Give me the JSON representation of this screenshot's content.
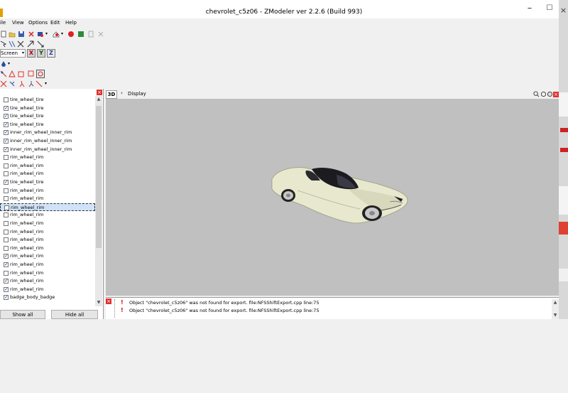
{
  "window": {
    "title": "chevrolet_c5z06 - ZModeler ver 2.2.6 (Build 993)",
    "minimize": "–",
    "maximize": "☐"
  },
  "menu": [
    {
      "label": "ile",
      "key": ""
    },
    {
      "label": "View",
      "key": "V"
    },
    {
      "label": "Options",
      "key": "O"
    },
    {
      "label": "Edit",
      "key": "E"
    },
    {
      "label": "Help",
      "key": "H"
    }
  ],
  "toolbar": {
    "view_mode": "Screen",
    "axis_x": "X",
    "axis_y": "Y",
    "axis_z": "Z"
  },
  "viewport": {
    "mode": "3D",
    "display_label": "Display"
  },
  "objects": [
    {
      "name": "tire_wheel_tire",
      "checked": false
    },
    {
      "name": "tire_wheel_tire",
      "checked": true
    },
    {
      "name": "tire_wheel_tire",
      "checked": true
    },
    {
      "name": "tire_wheel_tire",
      "checked": true
    },
    {
      "name": "inner_rim_wheel_inner_rim",
      "checked": true
    },
    {
      "name": "inner_rim_wheel_inner_rim",
      "checked": true
    },
    {
      "name": "inner_rim_wheel_inner_rim",
      "checked": true
    },
    {
      "name": "rim_wheel_rim",
      "checked": false
    },
    {
      "name": "rim_wheel_rim",
      "checked": false
    },
    {
      "name": "rim_wheel_rim",
      "checked": false
    },
    {
      "name": "tire_wheel_tire",
      "checked": true
    },
    {
      "name": "rim_wheel_rim",
      "checked": false
    },
    {
      "name": "rim_wheel_rim",
      "checked": false
    },
    {
      "name": "rim_wheel_rim",
      "checked": false,
      "selected": true
    },
    {
      "name": "rim_wheel_rim",
      "checked": false
    },
    {
      "name": "rim_wheel_rim",
      "checked": false
    },
    {
      "name": "rim_wheel_rim",
      "checked": false
    },
    {
      "name": "rim_wheel_rim",
      "checked": false
    },
    {
      "name": "rim_wheel_rim",
      "checked": false
    },
    {
      "name": "rim_wheel_rim",
      "checked": true
    },
    {
      "name": "rim_wheel_rim",
      "checked": true
    },
    {
      "name": "rim_wheel_rim",
      "checked": false
    },
    {
      "name": "rim_wheel_rim",
      "checked": true
    },
    {
      "name": "rim_wheel_rim",
      "checked": true
    },
    {
      "name": "badge_body_badge",
      "checked": true
    }
  ],
  "buttons": {
    "show_all": "Show all",
    "hide_all": "Hide all"
  },
  "log": [
    "Object \"chevrolet_c5z06\" was not found for export. file:NFSShiftExport.cpp line:75",
    "Object \"chevrolet_c5z06\" was not found for export. file:NFSShiftExport.cpp line:75"
  ],
  "colors": {
    "viewport_bg": "#c0c0c0",
    "car_body": "#e8e8cf",
    "error_icon": "#d40000"
  }
}
